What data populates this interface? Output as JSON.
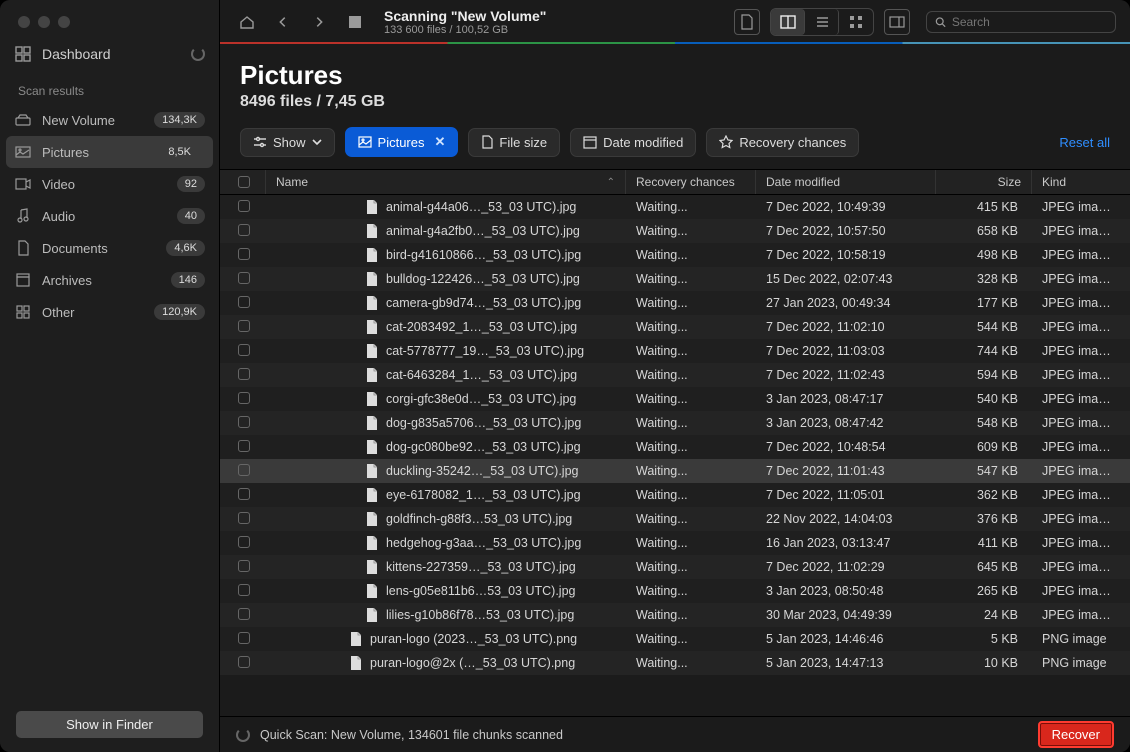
{
  "sidebar": {
    "dashboard": "Dashboard",
    "section_label": "Scan results",
    "items": [
      {
        "icon": "drive",
        "label": "New Volume",
        "badge": "134,3K"
      },
      {
        "icon": "picture",
        "label": "Pictures",
        "badge": "8,5K",
        "active": true
      },
      {
        "icon": "video",
        "label": "Video",
        "badge": "92"
      },
      {
        "icon": "audio",
        "label": "Audio",
        "badge": "40"
      },
      {
        "icon": "document",
        "label": "Documents",
        "badge": "4,6K"
      },
      {
        "icon": "archive",
        "label": "Archives",
        "badge": "146"
      },
      {
        "icon": "other",
        "label": "Other",
        "badge": "120,9K"
      }
    ],
    "finder_btn": "Show in Finder"
  },
  "topbar": {
    "title": "Scanning \"New Volume\"",
    "subtitle": "133 600 files / 100,52 GB",
    "search_placeholder": "Search"
  },
  "heading": {
    "title": "Pictures",
    "subtitle": "8496 files / 7,45 GB"
  },
  "filters": {
    "show": "Show",
    "pictures": "Pictures",
    "file_size": "File size",
    "date_modified": "Date modified",
    "recovery_chances": "Recovery chances",
    "reset": "Reset all"
  },
  "columns": {
    "name": "Name",
    "recovery": "Recovery chances",
    "date": "Date modified",
    "size": "Size",
    "kind": "Kind"
  },
  "rows": [
    {
      "name": "animal-g44a06…_53_03 UTC).jpg",
      "recovery": "Waiting...",
      "date": "7 Dec 2022, 10:49:39",
      "size": "415 KB",
      "kind": "JPEG ima…"
    },
    {
      "name": "animal-g4a2fb0…_53_03 UTC).jpg",
      "recovery": "Waiting...",
      "date": "7 Dec 2022, 10:57:50",
      "size": "658 KB",
      "kind": "JPEG ima…"
    },
    {
      "name": "bird-g41610866…_53_03 UTC).jpg",
      "recovery": "Waiting...",
      "date": "7 Dec 2022, 10:58:19",
      "size": "498 KB",
      "kind": "JPEG ima…"
    },
    {
      "name": "bulldog-122426…_53_03 UTC).jpg",
      "recovery": "Waiting...",
      "date": "15 Dec 2022, 02:07:43",
      "size": "328 KB",
      "kind": "JPEG ima…"
    },
    {
      "name": "camera-gb9d74…_53_03 UTC).jpg",
      "recovery": "Waiting...",
      "date": "27 Jan 2023, 00:49:34",
      "size": "177 KB",
      "kind": "JPEG ima…"
    },
    {
      "name": "cat-2083492_1…_53_03 UTC).jpg",
      "recovery": "Waiting...",
      "date": "7 Dec 2022, 11:02:10",
      "size": "544 KB",
      "kind": "JPEG ima…"
    },
    {
      "name": "cat-5778777_19…_53_03 UTC).jpg",
      "recovery": "Waiting...",
      "date": "7 Dec 2022, 11:03:03",
      "size": "744 KB",
      "kind": "JPEG ima…"
    },
    {
      "name": "cat-6463284_1…_53_03 UTC).jpg",
      "recovery": "Waiting...",
      "date": "7 Dec 2022, 11:02:43",
      "size": "594 KB",
      "kind": "JPEG ima…"
    },
    {
      "name": "corgi-gfc38e0d…_53_03 UTC).jpg",
      "recovery": "Waiting...",
      "date": "3 Jan 2023, 08:47:17",
      "size": "540 KB",
      "kind": "JPEG ima…"
    },
    {
      "name": "dog-g835a5706…_53_03 UTC).jpg",
      "recovery": "Waiting...",
      "date": "3 Jan 2023, 08:47:42",
      "size": "548 KB",
      "kind": "JPEG ima…"
    },
    {
      "name": "dog-gc080be92…_53_03 UTC).jpg",
      "recovery": "Waiting...",
      "date": "7 Dec 2022, 10:48:54",
      "size": "609 KB",
      "kind": "JPEG ima…"
    },
    {
      "name": "duckling-35242…_53_03 UTC).jpg",
      "recovery": "Waiting...",
      "date": "7 Dec 2022, 11:01:43",
      "size": "547 KB",
      "kind": "JPEG ima…",
      "selected": true
    },
    {
      "name": "eye-6178082_1…_53_03 UTC).jpg",
      "recovery": "Waiting...",
      "date": "7 Dec 2022, 11:05:01",
      "size": "362 KB",
      "kind": "JPEG ima…"
    },
    {
      "name": "goldfinch-g88f3…53_03 UTC).jpg",
      "recovery": "Waiting...",
      "date": "22 Nov 2022, 14:04:03",
      "size": "376 KB",
      "kind": "JPEG ima…"
    },
    {
      "name": "hedgehog-g3aa…_53_03 UTC).jpg",
      "recovery": "Waiting...",
      "date": "16 Jan 2023, 03:13:47",
      "size": "411 KB",
      "kind": "JPEG ima…"
    },
    {
      "name": "kittens-227359…_53_03 UTC).jpg",
      "recovery": "Waiting...",
      "date": "7 Dec 2022, 11:02:29",
      "size": "645 KB",
      "kind": "JPEG ima…"
    },
    {
      "name": "lens-g05e811b6…53_03 UTC).jpg",
      "recovery": "Waiting...",
      "date": "3 Jan 2023, 08:50:48",
      "size": "265 KB",
      "kind": "JPEG ima…"
    },
    {
      "name": "lilies-g10b86f78…53_03 UTC).jpg",
      "recovery": "Waiting...",
      "date": "30 Mar 2023, 04:49:39",
      "size": "24 KB",
      "kind": "JPEG ima…"
    },
    {
      "name": "puran-logo (2023…_53_03 UTC).png",
      "recovery": "Waiting...",
      "date": "5 Jan 2023, 14:46:46",
      "size": "5 KB",
      "kind": "PNG image",
      "short": true
    },
    {
      "name": "puran-logo@2x (…_53_03 UTC).png",
      "recovery": "Waiting...",
      "date": "5 Jan 2023, 14:47:13",
      "size": "10 KB",
      "kind": "PNG image",
      "short": true
    }
  ],
  "bottom": {
    "status": "Quick Scan: New Volume, 134601 file chunks scanned",
    "recover": "Recover"
  }
}
